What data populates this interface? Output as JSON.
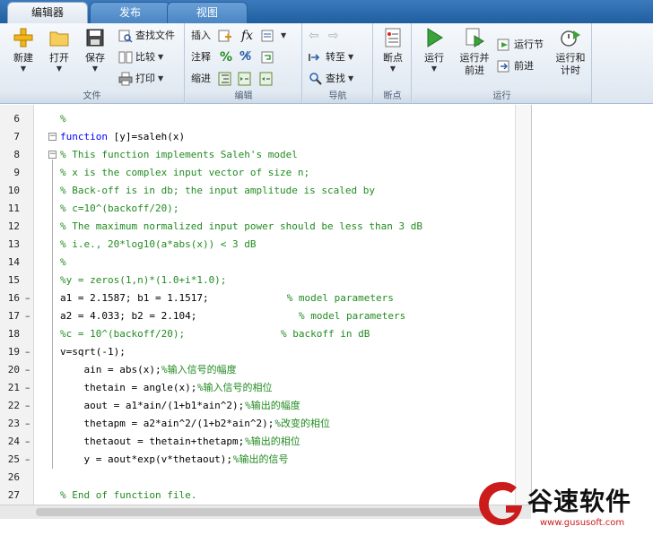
{
  "tabs": [
    {
      "label": "编辑器",
      "active": true
    },
    {
      "label": "发布",
      "active": false
    },
    {
      "label": "视图",
      "active": false
    }
  ],
  "ribbon": {
    "file": {
      "group_label": "文件",
      "new_label": "新建",
      "open_label": "打开",
      "save_label": "保存",
      "find_files_label": "查找文件",
      "compare_label": "比较",
      "print_label": "打印"
    },
    "edit": {
      "group_label": "编辑",
      "insert_label": "插入",
      "comment_label": "注释",
      "indent_label": "缩进",
      "fx_label": "fx"
    },
    "navigate": {
      "group_label": "导航",
      "goto_label": "转至",
      "find_label": "查找"
    },
    "breakpoints": {
      "group_label": "断点",
      "breakpoints_label": "断点"
    },
    "run": {
      "group_label": "运行",
      "run_label": "运行",
      "run_advance_label_1": "运行并",
      "run_advance_label_2": "前进",
      "run_section_label": "运行节",
      "advance_label": "前进",
      "run_time_label_1": "运行和",
      "run_time_label_2": "计时"
    }
  },
  "editor": {
    "lines": [
      {
        "num": "6",
        "text": "%",
        "type": "comment",
        "dash": false
      },
      {
        "num": "7",
        "text": "function [y]=saleh(x)",
        "type": "function",
        "dash": false
      },
      {
        "num": "8",
        "text": "% This function implements Saleh's model",
        "type": "comment",
        "dash": false
      },
      {
        "num": "9",
        "text": "% x is the complex input vector of size n;",
        "type": "comment",
        "dash": false
      },
      {
        "num": "10",
        "text": "% Back-off is in db; the input amplitude is scaled by",
        "type": "comment",
        "dash": false
      },
      {
        "num": "11",
        "text": "% c=10^(backoff/20);",
        "type": "comment",
        "dash": false
      },
      {
        "num": "12",
        "text": "% The maximum normalized input power should be less than 3 dB",
        "type": "comment",
        "dash": false
      },
      {
        "num": "13",
        "text": "% i.e., 20*log10(a*abs(x)) < 3 dB",
        "type": "comment",
        "dash": false
      },
      {
        "num": "14",
        "text": "%",
        "type": "comment",
        "dash": false
      },
      {
        "num": "15",
        "text": "%y = zeros(1,n)*(1.0+i*1.0);",
        "type": "comment",
        "dash": false
      },
      {
        "num": "16",
        "text": "a1 = 2.1587; b1 = 1.1517;",
        "type": "code",
        "trail": "% model parameters",
        "trail_col": 38,
        "dash": true
      },
      {
        "num": "17",
        "text": "a2 = 4.033; b2 = 2.104;",
        "type": "code",
        "trail": "% model parameters",
        "trail_col": 40,
        "dash": true
      },
      {
        "num": "18",
        "text": "%c = 10^(backoff/20);",
        "type": "comment",
        "trail": "% backoff in dB",
        "trail_col": 37,
        "dash": false
      },
      {
        "num": "19",
        "text": "v=sqrt(-1);",
        "type": "code",
        "dash": true
      },
      {
        "num": "20",
        "text": "    ain = abs(x);",
        "type": "code",
        "trail": "%输入信号的幅度",
        "trail_col": 17,
        "dash": true
      },
      {
        "num": "21",
        "text": "    thetain = angle(x);",
        "type": "code",
        "trail": "%输入信号的相位",
        "trail_col": 23,
        "dash": true
      },
      {
        "num": "22",
        "text": "    aout = a1*ain/(1+b1*ain^2);",
        "type": "code",
        "trail": "%输出的幅度",
        "trail_col": 31,
        "dash": true
      },
      {
        "num": "23",
        "text": "    thetapm = a2*ain^2/(1+b2*ain^2);",
        "type": "code",
        "trail": "%改变的相位",
        "trail_col": 36,
        "dash": true
      },
      {
        "num": "24",
        "text": "    thetaout = thetain+thetapm;",
        "type": "code",
        "trail": "%输出的相位",
        "trail_col": 31,
        "dash": true
      },
      {
        "num": "25",
        "text": "    y = aout*exp(v*thetaout);",
        "type": "code",
        "trail": "%输出的信号",
        "trail_col": 29,
        "dash": true
      },
      {
        "num": "26",
        "text": "",
        "type": "code",
        "dash": false
      },
      {
        "num": "27",
        "text": "% End of function file.",
        "type": "comment",
        "dash": false
      }
    ]
  },
  "watermark": {
    "title": "谷速软件",
    "url": "www.gususoft.com"
  },
  "colors": {
    "comment": "#228b22",
    "keyword": "#0000ff",
    "tabbar": "#2b6cae",
    "watermark_red": "#cc1b1b"
  }
}
